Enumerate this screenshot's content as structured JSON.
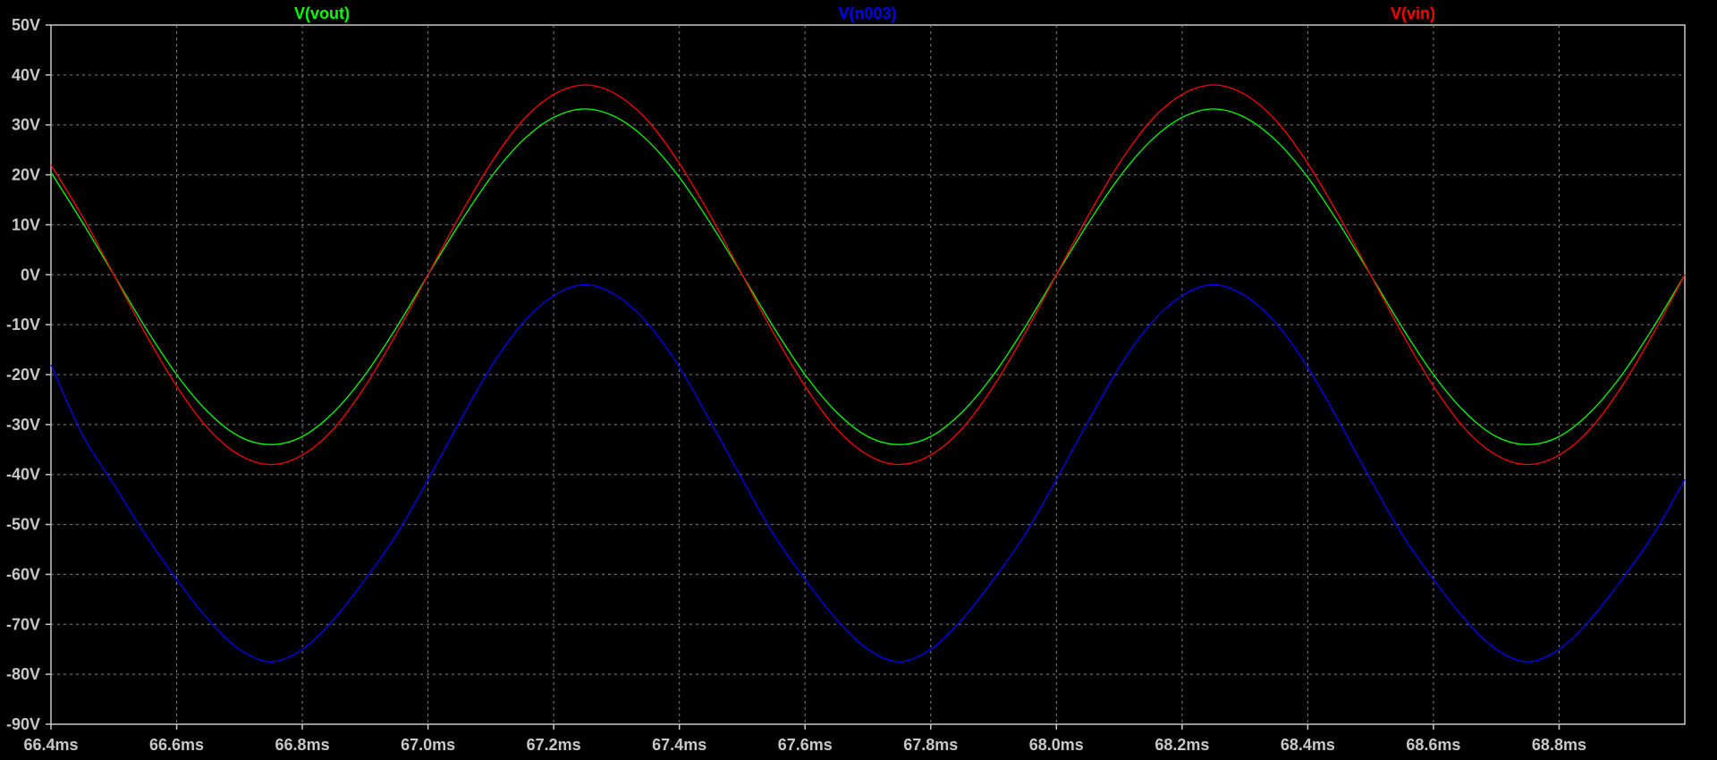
{
  "chart_data": {
    "type": "line",
    "title": "",
    "xlabel": "",
    "ylabel": "",
    "xlim": [
      66.4,
      69.0
    ],
    "ylim": [
      -90,
      50
    ],
    "grid": true,
    "legend_placement": "top",
    "background_color": "#000000",
    "grid_color": "#808080",
    "axis_color": "#c8c8c8",
    "x_ticks": [
      66.4,
      66.6,
      66.8,
      67.0,
      67.2,
      67.4,
      67.6,
      67.8,
      68.0,
      68.2,
      68.4,
      68.6,
      68.8
    ],
    "x_tick_labels": [
      "66.4ms",
      "66.6ms",
      "66.8ms",
      "67.0ms",
      "67.2ms",
      "67.4ms",
      "67.6ms",
      "67.8ms",
      "68.0ms",
      "68.2ms",
      "68.4ms",
      "68.6ms",
      "68.8ms"
    ],
    "y_ticks": [
      50,
      40,
      30,
      20,
      10,
      0,
      -10,
      -20,
      -30,
      -40,
      -50,
      -60,
      -70,
      -80,
      -90
    ],
    "y_tick_labels": [
      "50V",
      "40V",
      "30V",
      "20V",
      "10V",
      "0V",
      "-10V",
      "-20V",
      "-30V",
      "-40V",
      "-50V",
      "-60V",
      "-70V",
      "-80V",
      "-90V"
    ],
    "x": [
      66.4,
      66.45,
      66.5,
      66.55,
      66.6,
      66.65,
      66.7,
      66.75,
      66.8,
      66.85,
      66.9,
      66.95,
      67.0,
      67.05,
      67.1,
      67.15,
      67.2,
      67.25,
      67.3,
      67.35,
      67.4,
      67.45,
      67.5,
      67.55,
      67.6,
      67.65,
      67.7,
      67.75,
      67.8,
      67.85,
      67.9,
      67.95,
      68.0,
      68.05,
      68.1,
      68.15,
      68.2,
      68.25,
      68.3,
      68.35,
      68.4,
      68.45,
      68.5,
      68.55,
      68.6,
      68.65,
      68.7,
      68.75,
      68.8,
      68.85,
      68.9,
      68.95,
      69.0
    ],
    "series": [
      {
        "name": "V(vout)",
        "color": "#00ff00",
        "values": [
          20.5,
          10.5,
          0,
          -10.5,
          -20,
          -27.5,
          -32.4,
          -34.0,
          -32.4,
          -27.5,
          -20,
          -10.5,
          0,
          10.2,
          19.5,
          26.8,
          31.5,
          33.2,
          31.5,
          26.8,
          19.5,
          10.2,
          0,
          -10.5,
          -20,
          -27.5,
          -32.4,
          -34.0,
          -32.4,
          -27.5,
          -20,
          -10.5,
          0,
          10.2,
          19.5,
          26.8,
          31.5,
          33.2,
          31.5,
          26.8,
          19.5,
          10.2,
          0,
          -10.5,
          -20,
          -27.5,
          -32.4,
          -34.0,
          -32.4,
          -27.5,
          -20,
          -10.5,
          0
        ]
      },
      {
        "name": "V(n003)",
        "color": "#0000ff",
        "values": [
          -18,
          -32,
          -42,
          -52,
          -61,
          -69,
          -75,
          -77.5,
          -75,
          -69,
          -61,
          -52,
          -41,
          -29.5,
          -18.5,
          -9.8,
          -4.2,
          -2.0,
          -4.2,
          -9.8,
          -18.5,
          -29.5,
          -41,
          -52,
          -61,
          -69,
          -75,
          -77.5,
          -75,
          -69,
          -61,
          -52,
          -41,
          -29.5,
          -18.5,
          -9.8,
          -4.2,
          -2.0,
          -4.2,
          -9.8,
          -18.5,
          -29.5,
          -41,
          -52,
          -61,
          -69,
          -75,
          -77.5,
          -75,
          -69,
          -61,
          -52,
          -41
        ]
      },
      {
        "name": "V(vin)",
        "color": "#ff0000",
        "values": [
          22,
          11.7,
          0,
          -11.7,
          -22.3,
          -30.8,
          -36.1,
          -38.0,
          -36.1,
          -30.8,
          -22.3,
          -11.7,
          0,
          11.7,
          22.3,
          30.8,
          36.1,
          38.0,
          36.1,
          30.8,
          22.3,
          11.7,
          0,
          -11.7,
          -22.3,
          -30.8,
          -36.1,
          -38.0,
          -36.1,
          -30.8,
          -22.3,
          -11.7,
          0,
          11.7,
          22.3,
          30.8,
          36.1,
          38.0,
          36.1,
          30.8,
          22.3,
          11.7,
          0,
          -11.7,
          -22.3,
          -30.8,
          -36.1,
          -38.0,
          -36.1,
          -30.8,
          -22.3,
          -11.7,
          0
        ]
      }
    ]
  }
}
